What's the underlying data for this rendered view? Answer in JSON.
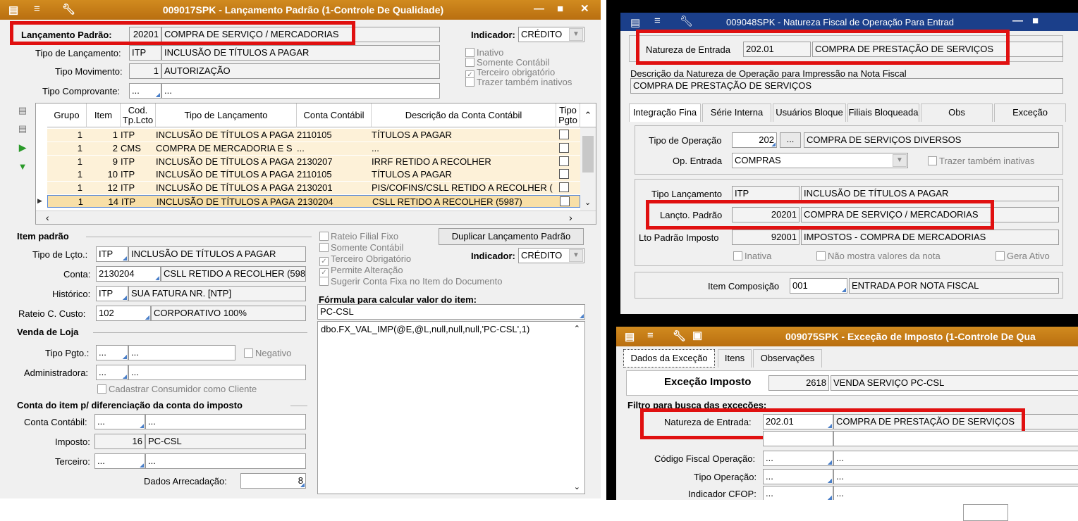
{
  "w1": {
    "title": "009017SPK - Lançamento Padrão (1-Controle De Qualidade)",
    "lanc_label": "Lançamento Padrão:",
    "lanc_code": "20201",
    "lanc_desc": "COMPRA DE SERVIÇO / MERCADORIAS",
    "ind_label": "Indicador:",
    "ind_value": "CRÉDITO",
    "tipo_lanc_label": "Tipo de Lançamento:",
    "tipo_lanc_code": "ITP",
    "tipo_lanc_desc": "INCLUSÃO DE TÍTULOS A PAGAR",
    "tipo_mov_label": "Tipo Movimento:",
    "tipo_mov_code": "1",
    "tipo_mov_desc": "AUTORIZAÇÃO",
    "tipo_comp_label": "Tipo Comprovante:",
    "tipo_comp_code": "...",
    "tipo_comp_desc": "...",
    "chk": [
      "Inativo",
      "Somente Contábil",
      "Terceiro obrigatório",
      "Trazer também inativos"
    ],
    "grid_headers": [
      "Grupo",
      "Item",
      "Cod. Tp.Lcto",
      "Tipo de Lançamento",
      "Conta Contábil",
      "Descrição da Conta Contábil",
      "Tipo Pgto"
    ],
    "rows": [
      [
        "1",
        "1",
        "ITP",
        "INCLUSÃO DE TÍTULOS A PAGA",
        "2110105",
        "TÍTULOS A PAGAR"
      ],
      [
        "1",
        "2",
        "CMS",
        "COMPRA DE MERCADORIA E S",
        "...",
        "..."
      ],
      [
        "1",
        "9",
        "ITP",
        "INCLUSÃO DE TÍTULOS A PAGA",
        "2130207",
        "IRRF RETIDO A RECOLHER"
      ],
      [
        "1",
        "10",
        "ITP",
        "INCLUSÃO DE TÍTULOS A PAGA",
        "2110105",
        "TÍTULOS A PAGAR"
      ],
      [
        "1",
        "12",
        "ITP",
        "INCLUSÃO DE TÍTULOS A PAGA",
        "2130201",
        "PIS/COFINS/CSLL RETIDO A RECOLHER ("
      ],
      [
        "1",
        "14",
        "ITP",
        "INCLUSÃO DE TÍTULOS A PAGA",
        "2130204",
        "CSLL RETIDO A RECOLHER (5987)"
      ]
    ],
    "item_padrao": "Item padrão",
    "rateio_filial": "Rateio Filial Fixo",
    "dup_btn": "Duplicar Lançamento Padrão",
    "somente_contabil": "Somente Contábil",
    "terceiro": "Terceiro Obrigatório",
    "permite": "Permite Alteração",
    "sugerir": "Sugerir Conta Fixa no Item do Documento",
    "tipo_lcto_label": "Tipo de Lçto.:",
    "tipo_lcto_code": "ITP",
    "tipo_lcto_desc": "INCLUSÃO DE TÍTULOS A PAGAR",
    "conta_label": "Conta:",
    "conta_code": "2130204",
    "conta_desc": "CSLL RETIDO A RECOLHER (598",
    "hist_label": "Histórico:",
    "hist_code": "ITP",
    "hist_desc": "SUA FATURA NR. [NTP]",
    "rateio_label": "Rateio C. Custo:",
    "rateio_code": "102",
    "rateio_desc": "CORPORATIVO 100%",
    "venda_loja": "Venda de Loja",
    "tipo_pgto_label": "Tipo Pgto.:",
    "tipo_pgto_code": "...",
    "tipo_pgto_desc": "...",
    "negativo": "Negativo",
    "admin_label": "Administradora:",
    "admin_code": "...",
    "admin_desc": "...",
    "cadastrar": "Cadastrar Consumidor como Cliente",
    "conta_item_title": "Conta do item p/ diferenciação da conta do imposto",
    "conta_contabil_label": "Conta Contábil:",
    "conta_contabil_code": "...",
    "conta_contabil_desc": "...",
    "imposto_label": "Imposto:",
    "imposto_code": "16",
    "imposto_desc": "PC-CSL",
    "terceiro_label": "Terceiro:",
    "terceiro_code": "...",
    "terceiro_desc": "...",
    "dados_arrec_label": "Dados Arrecadação:",
    "dados_arrec_value": "8",
    "formula_label": "Fórmula para calcular valor do item:",
    "formula_name": "PC-CSL",
    "formula_text": "dbo.FX_VAL_IMP(@E,@L,null,null,null,'PC-CSL',1)"
  },
  "w2": {
    "title": "009048SPK - Natureza Fiscal de Operação Para Entrad",
    "nat_label": "Natureza de Entrada",
    "nat_code": "202.01",
    "nat_desc": "COMPRA DE PRESTAÇÃO DE SERVIÇOS",
    "desc_label": "Descrição da Natureza de Operação para Impressão na Nota Fiscal",
    "desc_value": "COMPRA DE PRESTAÇÃO DE SERVIÇOS",
    "tabs": [
      "Integração Fina",
      "Série Interna",
      "Usuários Bloque",
      "Filiais Bloqueada",
      "Obs",
      "Exceção"
    ],
    "tipo_op_label": "Tipo de Operação",
    "tipo_op_code": "202",
    "tipo_op_btn": "...",
    "tipo_op_desc": "COMPRA DE SERVIÇOS DIVERSOS",
    "op_entrada_label": "Op. Entrada",
    "op_entrada_value": "COMPRAS",
    "trazer": "Trazer também inativas",
    "tipo_lanc_label": "Tipo Lançamento",
    "tipo_lanc_code": "ITP",
    "tipo_lanc_desc": "INCLUSÃO DE TÍTULOS A PAGAR",
    "lancto_label": "Lançto. Padrão",
    "lancto_code": "20201",
    "lancto_desc": "COMPRA DE SERVIÇO / MERCADORIAS",
    "lto_imp_label": "Lto Padrão Imposto",
    "lto_imp_code": "92001",
    "lto_imp_desc": "IMPOSTOS - COMPRA DE MERCADORIAS",
    "inativa": "Inativa",
    "nao_mostra": "Não mostra valores da nota",
    "gera_ativo": "Gera Ativo",
    "item_comp_label": "Item Composição",
    "item_comp_code": "001",
    "item_comp_desc": "ENTRADA POR NOTA FISCAL"
  },
  "w3": {
    "title": "009075SPK - Exceção de Imposto (1-Controle De Qua",
    "tabs": [
      "Dados da Exceção",
      "Itens",
      "Observações"
    ],
    "exc_label": "Exceção Imposto",
    "exc_code": "2618",
    "exc_desc": "VENDA SERVIÇO PC-CSL",
    "filtro": "Filtro para busca das exceções:",
    "nat_ent_label": "Natureza de Entrada:",
    "nat_ent_code": "202.01",
    "nat_ent_desc": "COMPRA DE PRESTAÇÃO DE SERVIÇOS",
    "cod_fiscal_label": "Código Fiscal Operação:",
    "cod_fiscal_code": "...",
    "cod_fiscal_desc": "...",
    "tipo_op_label": "Tipo Operação:",
    "tipo_op_code": "...",
    "tipo_op_desc": "...",
    "ind_cfop_label": "Indicador CFOP:",
    "ind_cfop_code": "...",
    "ind_cfop_desc": "..."
  }
}
